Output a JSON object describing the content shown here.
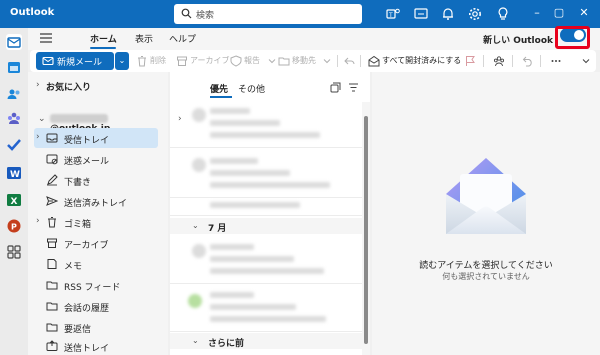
{
  "app": {
    "title": "Outlook"
  },
  "search": {
    "placeholder": "検索"
  },
  "menu": {
    "tabs": [
      {
        "label": "ホーム",
        "active": true
      },
      {
        "label": "表示",
        "active": false
      },
      {
        "label": "ヘルプ",
        "active": false
      }
    ],
    "new_outlook_label": "新しい Outlook",
    "new_outlook_toggle": true
  },
  "toolbar": {
    "new_mail_label": "新規メール",
    "delete_label": "削除",
    "archive_label": "アーカイブ",
    "report_label": "報告",
    "move_label": "移動先",
    "mark_all_read_label": "すべて開封済みにする"
  },
  "folders": {
    "favorites_label": "お気に入り",
    "account_suffix": "@outlook.jp",
    "items": [
      {
        "label": "受信トレイ",
        "icon": "inbox-icon",
        "selected": true,
        "expandable": true
      },
      {
        "label": "迷惑メール",
        "icon": "junk-icon",
        "selected": false,
        "expandable": false
      },
      {
        "label": "下書き",
        "icon": "draft-icon",
        "selected": false,
        "expandable": false
      },
      {
        "label": "送信済みトレイ",
        "icon": "send-icon",
        "selected": false,
        "expandable": false
      },
      {
        "label": "ゴミ箱",
        "icon": "trash-icon",
        "selected": false,
        "expandable": true
      },
      {
        "label": "アーカイブ",
        "icon": "archive-icon",
        "selected": false,
        "expandable": false
      },
      {
        "label": "メモ",
        "icon": "note-icon",
        "selected": false,
        "expandable": false
      },
      {
        "label": "RSS フィード",
        "icon": "folder-icon",
        "selected": false,
        "expandable": false
      },
      {
        "label": "会話の履歴",
        "icon": "folder-icon",
        "selected": false,
        "expandable": false
      },
      {
        "label": "要返信",
        "icon": "folder-icon",
        "selected": false,
        "expandable": false
      },
      {
        "label": "送信トレイ",
        "icon": "outbox-icon",
        "selected": false,
        "expandable": false
      }
    ]
  },
  "message_list": {
    "tabs": [
      {
        "label": "優先",
        "active": true
      },
      {
        "label": "その他",
        "active": false
      }
    ],
    "groups": [
      {
        "label": "7 月"
      },
      {
        "label": "さらに前"
      }
    ]
  },
  "reading_pane": {
    "empty_title": "読むアイテムを選択してください",
    "empty_subtitle": "何も選択されていません"
  },
  "colors": {
    "accent": "#0f6cbd",
    "highlight": "#e8001c"
  }
}
